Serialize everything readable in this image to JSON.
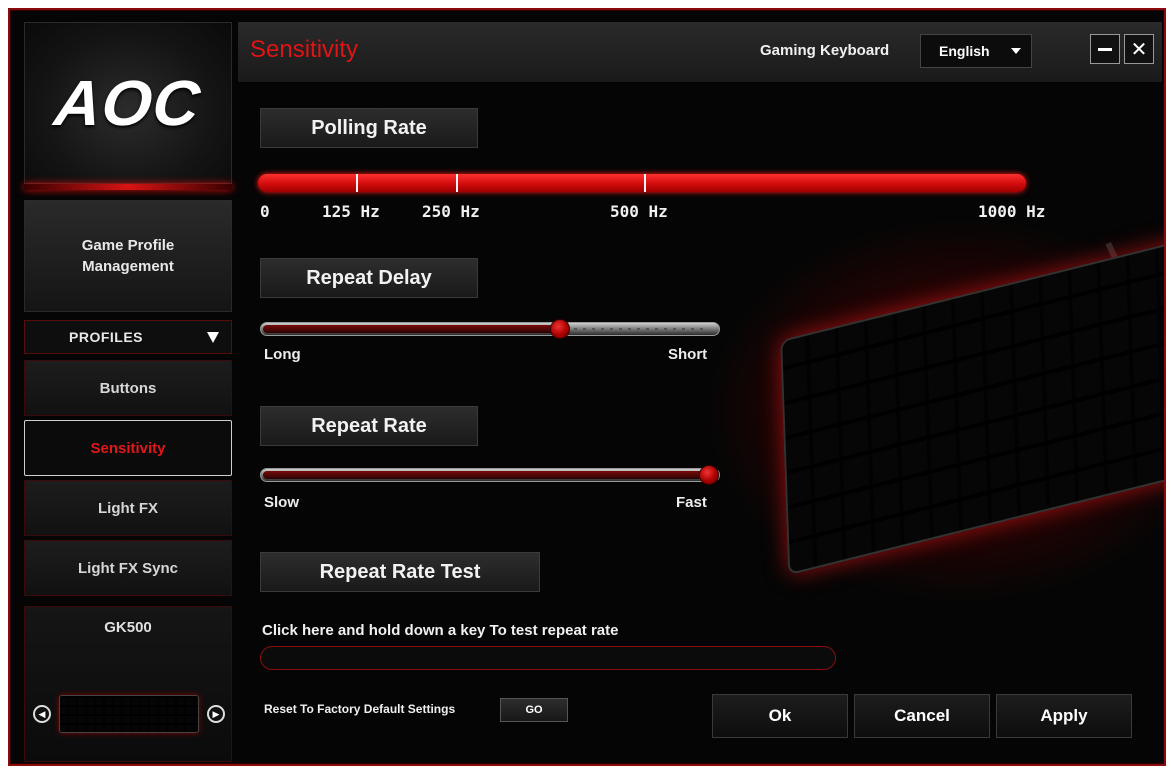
{
  "sidebar": {
    "logo": "AOC",
    "game_profile_management": "Game Profile Management",
    "profiles_label": "PROFILES",
    "items": [
      {
        "label": "Buttons",
        "active": false
      },
      {
        "label": "Sensitivity",
        "active": true
      },
      {
        "label": "Light FX",
        "active": false
      },
      {
        "label": "Light FX Sync",
        "active": false
      }
    ],
    "device_name": "GK500"
  },
  "header": {
    "title": "Sensitivity",
    "device_label": "Gaming Keyboard",
    "language": "English"
  },
  "polling_rate": {
    "label": "Polling Rate",
    "ticks": [
      "0",
      "125 Hz",
      "250 Hz",
      "500 Hz",
      "1000 Hz"
    ]
  },
  "repeat_delay": {
    "label": "Repeat Delay",
    "min_label": "Long",
    "max_label": "Short",
    "value": 0.66
  },
  "repeat_rate": {
    "label": "Repeat Rate",
    "min_label": "Slow",
    "max_label": "Fast",
    "value": 1.0
  },
  "repeat_rate_test": {
    "label": "Repeat Rate Test",
    "caption": "Click here and hold down a key To test repeat rate",
    "input_value": ""
  },
  "footer": {
    "reset_label": "Reset To Factory Default Settings",
    "go_label": "GO",
    "ok_label": "Ok",
    "cancel_label": "Cancel",
    "apply_label": "Apply"
  },
  "colors": {
    "accent": "#e01414",
    "background": "#050505"
  }
}
